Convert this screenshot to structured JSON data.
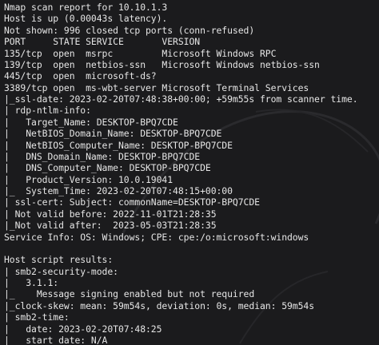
{
  "terminal": {
    "lines": [
      "Nmap scan report for 10.10.1.3",
      "Host is up (0.00043s latency).",
      "Not shown: 996 closed tcp ports (conn-refused)",
      "PORT     STATE SERVICE       VERSION",
      "135/tcp  open  msrpc         Microsoft Windows RPC",
      "139/tcp  open  netbios-ssn   Microsoft Windows netbios-ssn",
      "445/tcp  open  microsoft-ds?",
      "3389/tcp open  ms-wbt-server Microsoft Terminal Services",
      "|_ssl-date: 2023-02-20T07:48:38+00:00; +59m55s from scanner time.",
      "| rdp-ntlm-info:",
      "|   Target_Name: DESKTOP-BPQ7CDE",
      "|   NetBIOS_Domain_Name: DESKTOP-BPQ7CDE",
      "|   NetBIOS_Computer_Name: DESKTOP-BPQ7CDE",
      "|   DNS_Domain_Name: DESKTOP-BPQ7CDE",
      "|   DNS_Computer_Name: DESKTOP-BPQ7CDE",
      "|   Product_Version: 10.0.19041",
      "|_  System_Time: 2023-02-20T07:48:15+00:00",
      "| ssl-cert: Subject: commonName=DESKTOP-BPQ7CDE",
      "| Not valid before: 2022-11-01T21:28:35",
      "|_Not valid after:  2023-05-03T21:28:35",
      "Service Info: OS: Windows; CPE: cpe:/o:microsoft:windows",
      "",
      "Host script results:",
      "| smb2-security-mode:",
      "|   3.1.1:",
      "|_    Message signing enabled but not required",
      "|_clock-skew: mean: 59m54s, deviation: 0s, median: 59m54s",
      "| smb2-time:",
      "|   date: 2023-02-20T07:48:25",
      "|_  start_date: N/A"
    ]
  }
}
